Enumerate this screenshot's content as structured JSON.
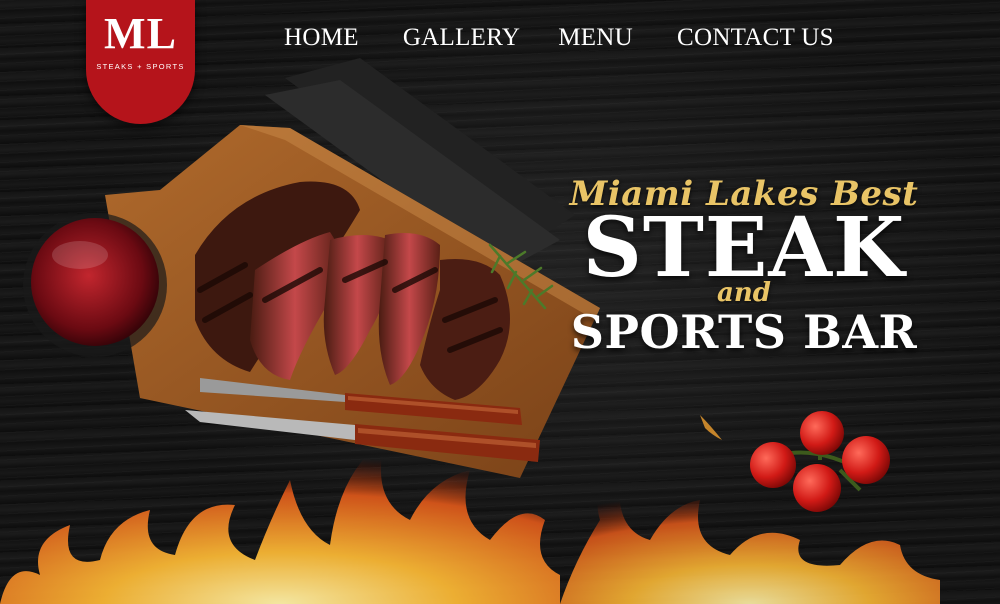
{
  "logo": {
    "mark": "ML",
    "tagline": "STEAKS + SPORTS"
  },
  "nav": {
    "items": [
      "HOME",
      "GALLERY",
      "MENU",
      "CONTACT US"
    ]
  },
  "hero": {
    "line1": "Miami Lakes Best",
    "line2": "STEAK",
    "line3": "and",
    "line4": "SPORTS BAR"
  },
  "colors": {
    "brand_red": "#b5141b",
    "gold": "#e9c466",
    "background": "#111111"
  },
  "icons": {
    "logo": "ml-logo-badge"
  }
}
